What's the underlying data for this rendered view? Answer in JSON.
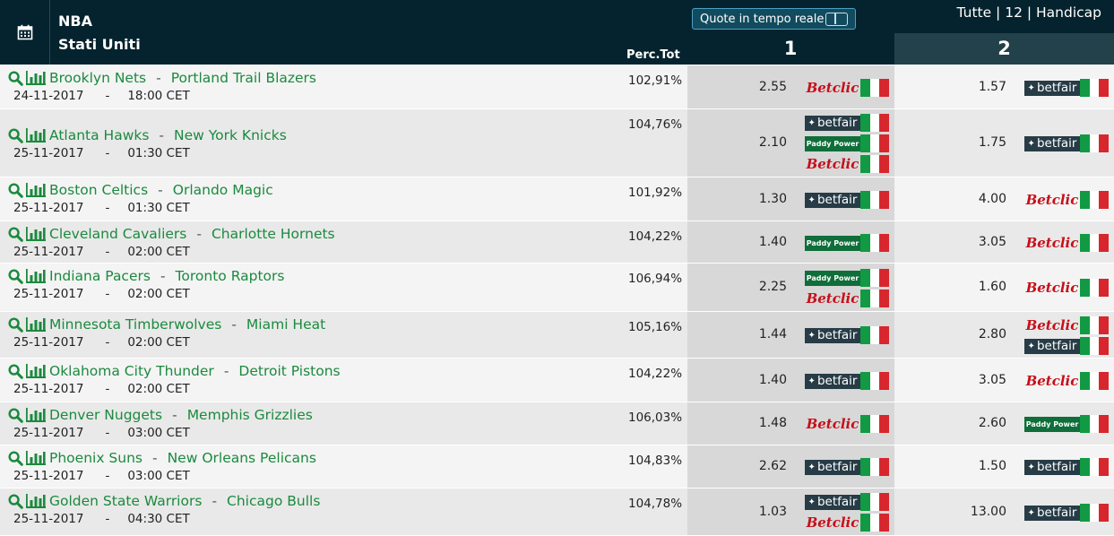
{
  "header": {
    "league": "NBA",
    "country": "Stati Uniti",
    "perc_label": "Perc.Tot",
    "realtime_label": "Quote in tempo reale",
    "filters": "Tutte | 12 | Handicap",
    "col1": "1",
    "col2": "2"
  },
  "matches": [
    {
      "home": "Brooklyn Nets",
      "away": "Portland Trail Blazers",
      "date": "24-11-2017",
      "time": "18:00 CET",
      "perc": "102,91%",
      "odd1": "2.55",
      "odd2": "1.57",
      "bk1": [
        "betclic"
      ],
      "bk2": [
        "betfair"
      ]
    },
    {
      "home": "Atlanta Hawks",
      "away": "New York Knicks",
      "date": "25-11-2017",
      "time": "01:30 CET",
      "perc": "104,76%",
      "odd1": "2.10",
      "odd2": "1.75",
      "bk1": [
        "betfair",
        "paddy",
        "betclic"
      ],
      "bk2": [
        "betfair"
      ]
    },
    {
      "home": "Boston Celtics",
      "away": "Orlando Magic",
      "date": "25-11-2017",
      "time": "01:30 CET",
      "perc": "101,92%",
      "odd1": "1.30",
      "odd2": "4.00",
      "bk1": [
        "betfair"
      ],
      "bk2": [
        "betclic"
      ]
    },
    {
      "home": "Cleveland Cavaliers",
      "away": "Charlotte Hornets",
      "date": "25-11-2017",
      "time": "02:00 CET",
      "perc": "104,22%",
      "odd1": "1.40",
      "odd2": "3.05",
      "bk1": [
        "paddy"
      ],
      "bk2": [
        "betclic"
      ]
    },
    {
      "home": "Indiana Pacers",
      "away": "Toronto Raptors",
      "date": "25-11-2017",
      "time": "02:00 CET",
      "perc": "106,94%",
      "odd1": "2.25",
      "odd2": "1.60",
      "bk1": [
        "paddy",
        "betclic"
      ],
      "bk2": [
        "betclic"
      ]
    },
    {
      "home": "Minnesota Timberwolves",
      "away": "Miami Heat",
      "date": "25-11-2017",
      "time": "02:00 CET",
      "perc": "105,16%",
      "odd1": "1.44",
      "odd2": "2.80",
      "bk1": [
        "betfair"
      ],
      "bk2": [
        "betclic",
        "betfair"
      ]
    },
    {
      "home": "Oklahoma City Thunder",
      "away": "Detroit Pistons",
      "date": "25-11-2017",
      "time": "02:00 CET",
      "perc": "104,22%",
      "odd1": "1.40",
      "odd2": "3.05",
      "bk1": [
        "betfair"
      ],
      "bk2": [
        "betclic"
      ]
    },
    {
      "home": "Denver Nuggets",
      "away": "Memphis Grizzlies",
      "date": "25-11-2017",
      "time": "03:00 CET",
      "perc": "106,03%",
      "odd1": "1.48",
      "odd2": "2.60",
      "bk1": [
        "betclic"
      ],
      "bk2": [
        "paddy"
      ]
    },
    {
      "home": "Phoenix Suns",
      "away": "New Orleans Pelicans",
      "date": "25-11-2017",
      "time": "03:00 CET",
      "perc": "104,83%",
      "odd1": "2.62",
      "odd2": "1.50",
      "bk1": [
        "betfair"
      ],
      "bk2": [
        "betfair"
      ]
    },
    {
      "home": "Golden State Warriors",
      "away": "Chicago Bulls",
      "date": "25-11-2017",
      "time": "04:30 CET",
      "perc": "104,78%",
      "odd1": "1.03",
      "odd2": "13.00",
      "bk1": [
        "betfair",
        "betclic"
      ],
      "bk2": [
        "betfair"
      ]
    }
  ],
  "bookmakers": {
    "betfair": "betfair",
    "paddy": "Paddy Power",
    "betclic": "Betclic"
  },
  "colors": {
    "header_bg": "#05232e",
    "team_link": "#1b8a3e",
    "flag_green": "#119a43",
    "flag_red": "#d7262d"
  }
}
